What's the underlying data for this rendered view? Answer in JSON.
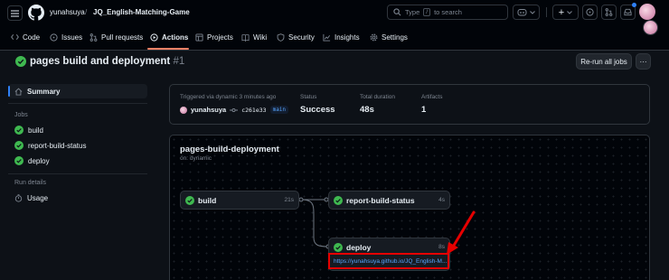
{
  "header": {
    "owner": "yunahsuya",
    "separator": "/",
    "repo": "JQ_English-Matching-Game",
    "search": {
      "prefix": "Type",
      "key": "/",
      "suffix": "to search"
    },
    "create_plus": "+"
  },
  "tabs": [
    {
      "label": "Code",
      "icon": "code-icon"
    },
    {
      "label": "Issues",
      "icon": "issue-icon"
    },
    {
      "label": "Pull requests",
      "icon": "pull-request-icon"
    },
    {
      "label": "Actions",
      "icon": "play-icon",
      "active": true
    },
    {
      "label": "Projects",
      "icon": "table-icon"
    },
    {
      "label": "Wiki",
      "icon": "book-icon"
    },
    {
      "label": "Security",
      "icon": "shield-icon"
    },
    {
      "label": "Insights",
      "icon": "graph-icon"
    },
    {
      "label": "Settings",
      "icon": "gear-icon"
    }
  ],
  "run": {
    "title": "pages build and deployment",
    "number": "#1",
    "rerun_label": "Re-run all jobs",
    "more_label": "···"
  },
  "sidebar": {
    "summary_label": "Summary",
    "jobs_heading": "Jobs",
    "jobs": [
      "build",
      "report-build-status",
      "deploy"
    ],
    "run_details_heading": "Run details",
    "usage_label": "Usage"
  },
  "summary": {
    "trigger_text": "Triggered via dynamic 3 minutes ago",
    "actor": "yunahsuya",
    "commit": "c261e33",
    "branch": "main",
    "status_label": "Status",
    "status_value": "Success",
    "duration_label": "Total duration",
    "duration_value": "48s",
    "artifacts_label": "Artifacts",
    "artifacts_value": "1"
  },
  "graph": {
    "workflow_name": "pages-build-deployment",
    "trigger": "on: dynamic",
    "jobs": {
      "build": {
        "name": "build",
        "duration": "21s"
      },
      "report": {
        "name": "report-build-status",
        "duration": "4s"
      },
      "deploy": {
        "name": "deploy",
        "duration": "8s",
        "url": "https://yunahsuya.github.io/JQ_English-M..."
      }
    }
  },
  "colors": {
    "success": "#3fb950",
    "accent": "#f78166",
    "link": "#58a6ff",
    "annotation": "#e60000"
  }
}
